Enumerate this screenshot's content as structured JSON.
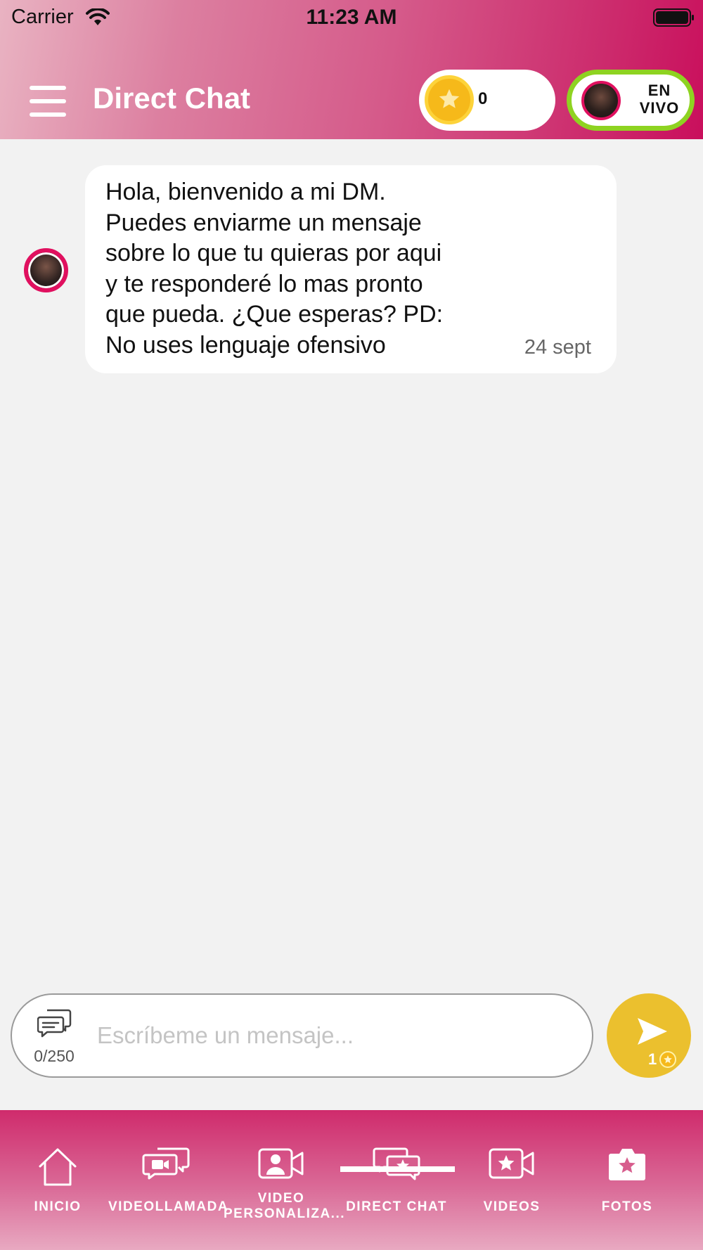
{
  "status_bar": {
    "carrier": "Carrier",
    "time": "11:23 AM"
  },
  "header": {
    "title": "Direct Chat",
    "coins_count": "0",
    "live_label": "EN VIVO"
  },
  "messages": [
    {
      "text": "Hola, bienvenido a mi DM.\nPuedes enviarme un mensaje\nsobre lo que tu quieras por aqui\ny te responderé lo mas pronto\nque pueda. ¿Que esperas? PD:\nNo uses lenguaje ofensivo",
      "time": "24 sept"
    }
  ],
  "composer": {
    "char_counter": "0/250",
    "placeholder": "Escríbeme un mensaje...",
    "send_cost": "1"
  },
  "tabs": [
    {
      "label": "INICIO",
      "icon": "home-icon"
    },
    {
      "label": "VIDEOLLAMADA",
      "icon": "video-call-icon"
    },
    {
      "label": "VIDEO PERSONALIZA...",
      "icon": "custom-video-icon"
    },
    {
      "label": "DIRECT CHAT",
      "icon": "direct-chat-icon",
      "active": true
    },
    {
      "label": "VIDEOS",
      "icon": "videos-icon"
    },
    {
      "label": "FOTOS",
      "icon": "photos-icon"
    }
  ],
  "colors": {
    "brand_pink": "#cc2a6c",
    "live_green": "#8ed321",
    "coin_gold": "#f6b91a",
    "send_yellow": "#ebc02e"
  }
}
